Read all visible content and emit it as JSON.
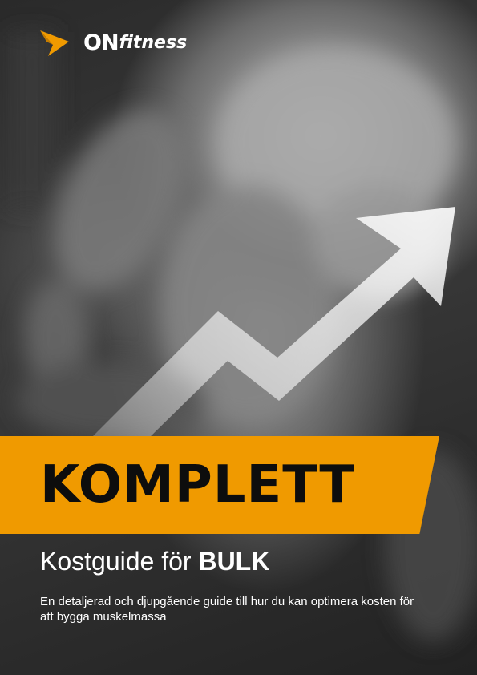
{
  "brand": {
    "name_bold": "ON",
    "name_rest": "fitness",
    "icon": "chevron-arrow-logo-icon",
    "accent_color": "#f09a00"
  },
  "cover": {
    "headline": "KOMPLETT",
    "subtitle_prefix": "Kostguide för ",
    "subtitle_bold": "BULK",
    "description": "En detaljerad och djupgående guide till hur du kan optimera kosten för att bygga muskelmassa",
    "banner_color": "#f09a00",
    "arrow_icon": "upward-trend-arrow-icon",
    "background": "grayscale gym photo of muscular torso"
  }
}
